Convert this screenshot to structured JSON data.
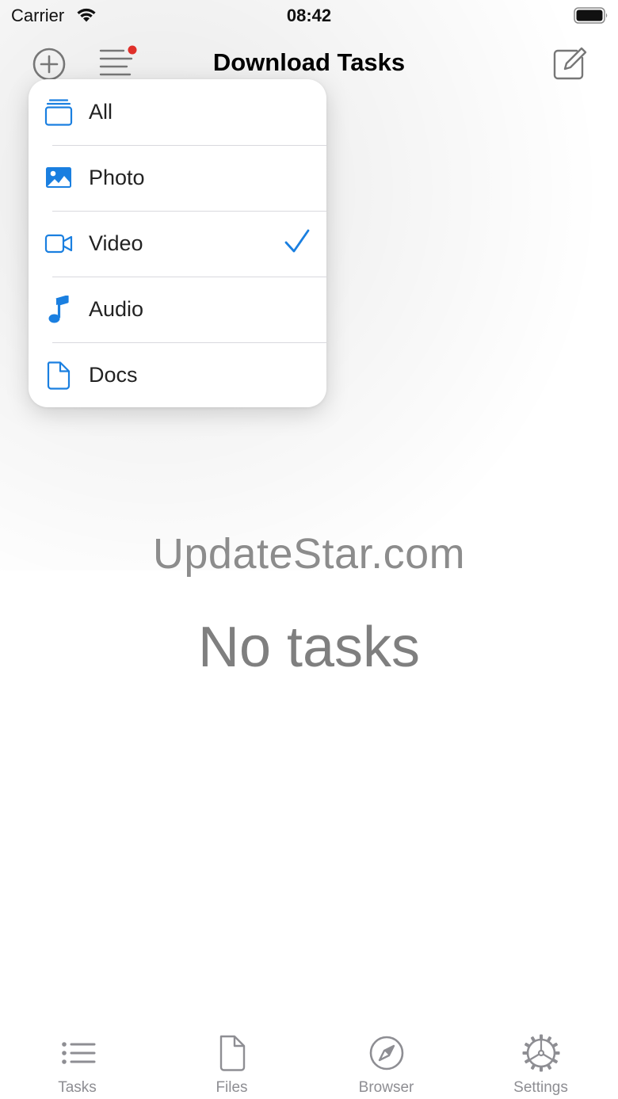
{
  "status_bar": {
    "carrier": "Carrier",
    "time": "08:42",
    "wifi_icon": "wifi-icon",
    "battery_icon": "battery-icon"
  },
  "nav": {
    "title": "Download Tasks",
    "add_icon": "plus-circle-icon",
    "filter_icon": "filter-lines-icon",
    "compose_icon": "compose-icon",
    "filter_badge_color": "#e0302a"
  },
  "filter_menu": {
    "items": [
      {
        "label": "All",
        "icon": "stack-icon",
        "selected": false
      },
      {
        "label": "Photo",
        "icon": "photo-icon",
        "selected": false
      },
      {
        "label": "Video",
        "icon": "video-icon",
        "selected": true
      },
      {
        "label": "Audio",
        "icon": "music-note-icon",
        "selected": false
      },
      {
        "label": "Docs",
        "icon": "document-icon",
        "selected": false
      }
    ]
  },
  "main": {
    "watermark": "UpdateStar.com",
    "empty_message": "No tasks"
  },
  "tab_bar": {
    "tabs": [
      {
        "label": "Tasks",
        "icon": "list-icon"
      },
      {
        "label": "Files",
        "icon": "file-icon"
      },
      {
        "label": "Browser",
        "icon": "compass-icon"
      },
      {
        "label": "Settings",
        "icon": "gear-icon"
      }
    ]
  },
  "colors": {
    "accent": "#1a7fe0",
    "icon_gray": "#8e8e93",
    "nav_icon": "#777777"
  }
}
